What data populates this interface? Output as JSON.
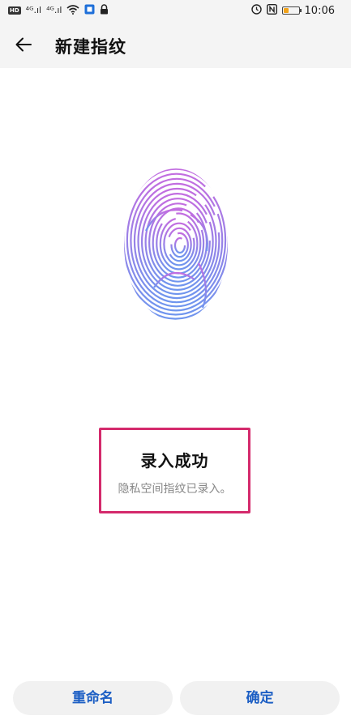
{
  "status_bar": {
    "left_icons": [
      "hd-icon",
      "signal-4g-icon",
      "signal-4g-icon",
      "wifi-icon",
      "shield-app-icon",
      "lock-icon"
    ],
    "signal_label_1": "⁴ᴳ.ıl",
    "signal_label_2": "⁴ᴳ.ıl",
    "hd_label": "HD",
    "right_icons": [
      "alarm-icon",
      "nfc-icon",
      "battery-icon"
    ],
    "battery_level": 0.35,
    "time": "10:06"
  },
  "app_bar": {
    "title": "新建指纹"
  },
  "fingerprint": {
    "icon": "fingerprint-icon",
    "gradient_top": "#c26de0",
    "gradient_bottom": "#6f95ee"
  },
  "result": {
    "title": "录入成功",
    "subtitle": "隐私空间指纹已录入。",
    "highlight_color": "#d42a6c"
  },
  "buttons": {
    "rename_label": "重命名",
    "confirm_label": "确定"
  },
  "colors": {
    "accent": "#1d5fc4",
    "background": "#ffffff",
    "bar_background": "#f4f4f4"
  }
}
